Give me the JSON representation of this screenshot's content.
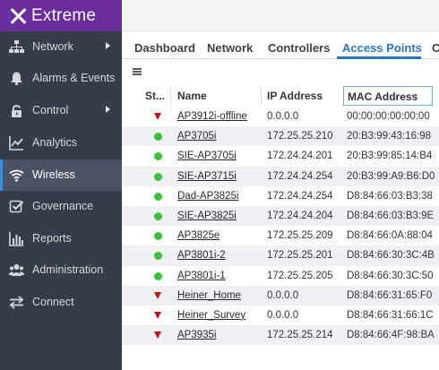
{
  "brand": {
    "name": "Extreme"
  },
  "sidebar": {
    "items": [
      {
        "label": "Network",
        "icon": "network-icon",
        "has_submenu": true,
        "active": false
      },
      {
        "label": "Alarms & Events",
        "icon": "bell-icon",
        "has_submenu": false,
        "active": false
      },
      {
        "label": "Control",
        "icon": "lock-icon",
        "has_submenu": true,
        "active": false
      },
      {
        "label": "Analytics",
        "icon": "line-chart-icon",
        "has_submenu": false,
        "active": false
      },
      {
        "label": "Wireless",
        "icon": "wifi-icon",
        "has_submenu": false,
        "active": true
      },
      {
        "label": "Governance",
        "icon": "checkbox-icon",
        "has_submenu": false,
        "active": false
      },
      {
        "label": "Reports",
        "icon": "bar-chart-icon",
        "has_submenu": false,
        "active": false
      },
      {
        "label": "Administration",
        "icon": "users-icon",
        "has_submenu": false,
        "active": false
      },
      {
        "label": "Connect",
        "icon": "swap-arrows-icon",
        "has_submenu": false,
        "active": false
      }
    ]
  },
  "tabs": [
    {
      "label": "Dashboard",
      "active": false
    },
    {
      "label": "Network",
      "active": false
    },
    {
      "label": "Controllers",
      "active": false
    },
    {
      "label": "Access Points",
      "active": true
    },
    {
      "label": "C",
      "active": false
    }
  ],
  "table": {
    "columns": [
      "St...",
      "Name",
      "IP Address",
      "MAC Address"
    ],
    "sort": {
      "column": "MAC Address",
      "direction": "ascending"
    },
    "rows": [
      {
        "status": "down",
        "name": "AP3912i-offline",
        "ip": "0.0.0.0",
        "mac": "00:00:00:00:00:00"
      },
      {
        "status": "up",
        "name": "AP3705i",
        "ip": "172.25.25.210",
        "mac": "20:B3:99:43:16:98"
      },
      {
        "status": "up",
        "name": "SIE-AP3705i",
        "ip": "172.24.24.201",
        "mac": "20:B3:99:85:14:B4"
      },
      {
        "status": "up",
        "name": "SIE-AP3715i",
        "ip": "172.24.24.254",
        "mac": "20:B3:99:A9:B6:D0"
      },
      {
        "status": "up",
        "name": "Dad-AP3825i",
        "ip": "172.24.24.254",
        "mac": "D8:84:66:03:B3:38"
      },
      {
        "status": "up",
        "name": "SIE-AP3825i",
        "ip": "172.24.24.204",
        "mac": "D8:84:66:03:B3:9E"
      },
      {
        "status": "up",
        "name": "AP3825e",
        "ip": "172.25.25.209",
        "mac": "D8:84:66:0A:88:04"
      },
      {
        "status": "up",
        "name": "AP3801i-2",
        "ip": "172.25.25.201",
        "mac": "D8:84:66:30:3C:4B"
      },
      {
        "status": "up",
        "name": "AP3801i-1",
        "ip": "172.25.25.205",
        "mac": "D8:84:66:30:3C:50"
      },
      {
        "status": "down",
        "name": "Heiner_Home",
        "ip": "0.0.0.0",
        "mac": "D8:84:66:31:65:F0"
      },
      {
        "status": "down",
        "name": "Heiner_Survey",
        "ip": "0.0.0.0",
        "mac": "D8:84:66:31:66:1C"
      },
      {
        "status": "down",
        "name": "AP3935i",
        "ip": "172.25.25.214",
        "mac": "D8:84:66:4F:98:BA"
      }
    ]
  },
  "colors": {
    "brand": "#6b2d9e",
    "sidebar": "#363c48",
    "accent": "#2a74c5",
    "status_up": "#3ac13a",
    "status_down": "#c0121c"
  }
}
